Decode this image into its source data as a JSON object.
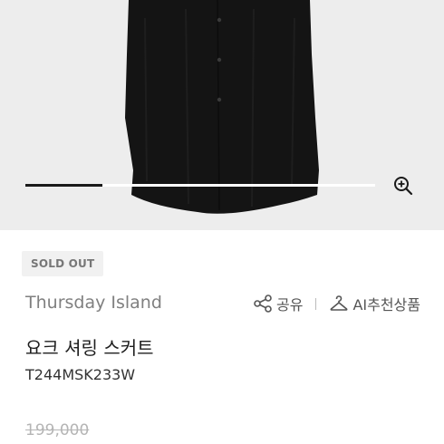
{
  "gallery": {
    "progress_fraction": 0.22,
    "zoom_icon": "zoom-in-icon"
  },
  "product": {
    "badge": "SOLD OUT",
    "brand": "Thursday Island",
    "title": "요크 셔링 스커트",
    "code": "T244MSK233W",
    "original_price": "199,000"
  },
  "actions": {
    "share_label": "공유",
    "share_icon": "share-icon",
    "ai_label": "AI추천상품",
    "ai_icon": "hanger-icon"
  },
  "colors": {
    "background_gray": "#ededed",
    "garment": "#141414",
    "badge_bg": "#f1f1f1",
    "muted_text": "#808080"
  }
}
